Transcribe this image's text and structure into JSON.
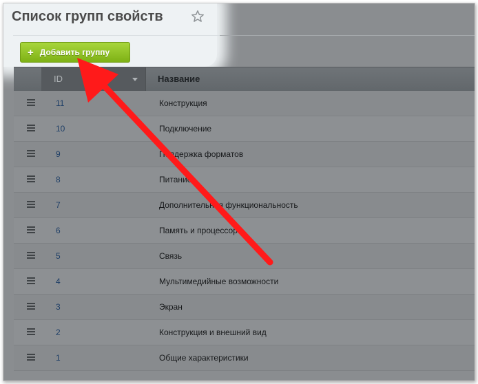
{
  "page": {
    "title": "Список групп свойств"
  },
  "toolbar": {
    "add_label": "Добавить группу"
  },
  "table": {
    "columns": {
      "id": "ID",
      "name": "Название"
    },
    "rows": [
      {
        "id": "11",
        "name": "Конструкция"
      },
      {
        "id": "10",
        "name": "Подключение"
      },
      {
        "id": "9",
        "name": "Поддержка форматов"
      },
      {
        "id": "8",
        "name": "Питание"
      },
      {
        "id": "7",
        "name": "Дополнительная функциональность"
      },
      {
        "id": "6",
        "name": "Память и процессор"
      },
      {
        "id": "5",
        "name": "Связь"
      },
      {
        "id": "4",
        "name": "Мультимедийные возможности"
      },
      {
        "id": "3",
        "name": "Экран"
      },
      {
        "id": "2",
        "name": "Конструкция и внешний вид"
      },
      {
        "id": "1",
        "name": "Общие характеристики"
      }
    ]
  },
  "colors": {
    "accent_green": "#8cc220",
    "annotation_arrow": "#ff1a1a"
  },
  "icons": {
    "favorite": "star-icon",
    "add": "plus-icon",
    "row_menu": "drag-handle-icon",
    "sort": "sort-down-icon"
  }
}
